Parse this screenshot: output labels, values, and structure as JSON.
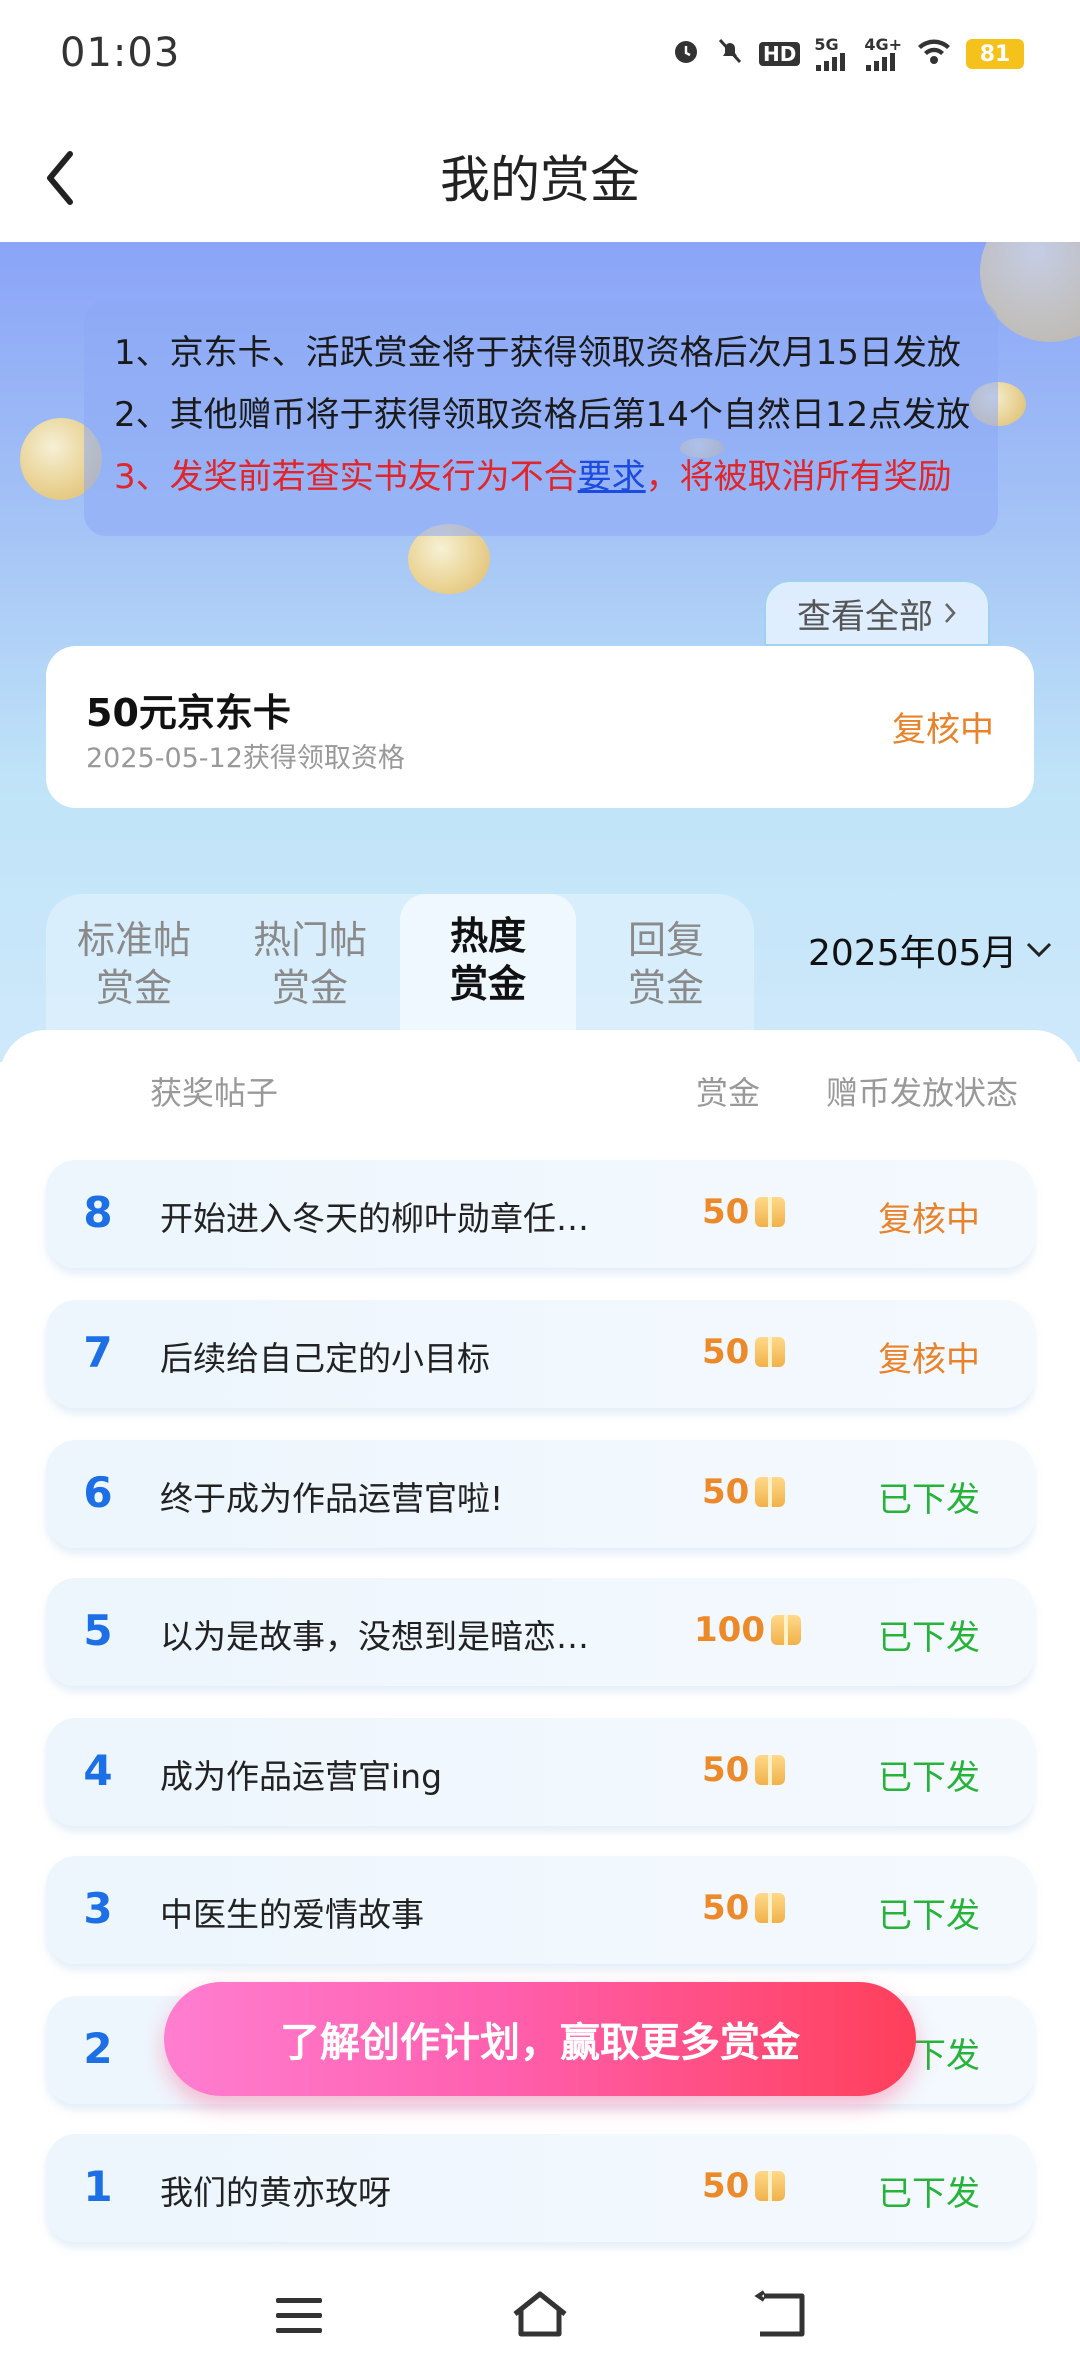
{
  "status_bar": {
    "time": "01:03",
    "icons": [
      "alarm-icon",
      "mute-icon",
      "hd-icon",
      "signal-5g-icon",
      "signal-4g-icon",
      "wifi-icon"
    ],
    "network_5g": "5G",
    "network_4g": "4G+",
    "hd": "HD",
    "battery": "81"
  },
  "header": {
    "back_icon": "back-chevron-icon",
    "title": "我的赏金"
  },
  "notice": {
    "line1": "1、京东卡、活跃赏金将于获得领取资格后次月15日发放",
    "line2": "2、其他赠币将于获得领取资格后第14个自然日12点发放",
    "line3_prefix": "3、发奖前若查实书友行为不合",
    "line3_link": "要求",
    "line3_suffix": "，将被取消所有奖励"
  },
  "view_all": {
    "label": "查看全部"
  },
  "jd_card": {
    "title": "50元京东卡",
    "date": "2025-05-12获得领取资格",
    "status": "复核中"
  },
  "tabs": [
    {
      "line1": "标准帖",
      "line2": "赏金",
      "active": false
    },
    {
      "line1": "热门帖",
      "line2": "赏金",
      "active": false
    },
    {
      "line1": "热度",
      "line2": "赏金",
      "active": true
    },
    {
      "line1": "回复",
      "line2": "赏金",
      "active": false
    }
  ],
  "date_picker": {
    "value": "2025年05月"
  },
  "columns": {
    "post": "获奖帖子",
    "reward": "赏金",
    "status": "赠币发放状态"
  },
  "rows": [
    {
      "rank": "8",
      "title": "开始进入冬天的柳叶勋章任…",
      "amount": "50",
      "status": "复核中"
    },
    {
      "rank": "7",
      "title": "后续给自己定的小目标",
      "amount": "50",
      "status": "复核中"
    },
    {
      "rank": "6",
      "title": "终于成为作品运营官啦!",
      "amount": "50",
      "status": "已下发"
    },
    {
      "rank": "5",
      "title": "以为是故事，没想到是暗恋…",
      "amount": "100",
      "status": "已下发"
    },
    {
      "rank": "4",
      "title": "成为作品运营官ing",
      "amount": "50",
      "status": "已下发"
    },
    {
      "rank": "3",
      "title": "中医生的爱情故事",
      "amount": "50",
      "status": "已下发"
    },
    {
      "rank": "2",
      "title": "",
      "amount": "",
      "status": "已下发"
    },
    {
      "rank": "1",
      "title": "我们的黄亦玫呀",
      "amount": "50",
      "status": "已下发"
    }
  ],
  "cta": {
    "label": "了解创作计划，赢取更多赏金"
  },
  "nav": {
    "menu_icon": "menu-icon",
    "home_icon": "home-icon",
    "back_icon": "back-icon"
  },
  "colors": {
    "accent_blue": "#1d6fe6",
    "review_orange": "#e9832b",
    "done_green": "#27b33a",
    "warning_red": "#e0262a",
    "cta_pink": "#ff5fae",
    "cta_red": "#ff3f5a"
  }
}
